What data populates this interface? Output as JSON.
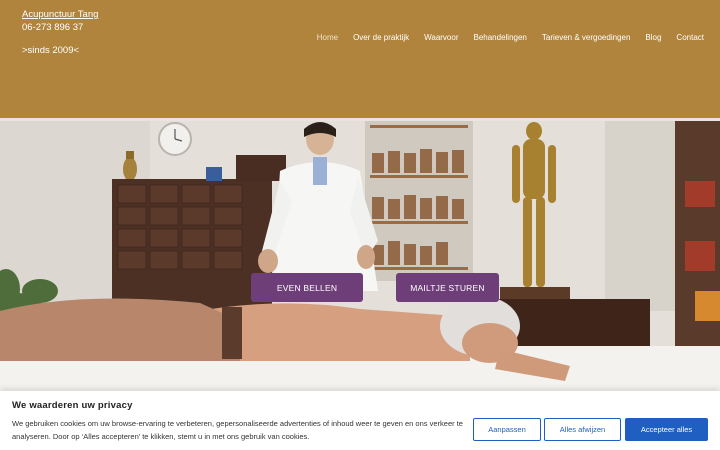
{
  "brand": {
    "name": "Acupunctuur Tang",
    "phone": "06-273 896 37",
    "since": ">sinds 2009<"
  },
  "nav": [
    {
      "label": "Home",
      "active": true
    },
    {
      "label": "Over de praktijk"
    },
    {
      "label": "Waarvoor"
    },
    {
      "label": "Behandelingen"
    },
    {
      "label": "Tarieven & vergoedingen"
    },
    {
      "label": "Blog"
    },
    {
      "label": "Contact"
    }
  ],
  "hero": {
    "image": "acupuncture-treatment-photo",
    "cta_call": "EVEN BELLEN",
    "cta_mail": "MAILTJE STUREN"
  },
  "cookie": {
    "title": "We waarderen uw privacy",
    "text": "We gebruiken cookies om uw browse-ervaring te verbeteren, gepersonaliseerde advertenties of inhoud weer te geven en ons verkeer te analyseren. Door op ‘Alles accepteren’ te klikken, stemt u in met ons gebruik van cookies.",
    "customize": "Aanpassen",
    "reject": "Alles afwijzen",
    "accept": "Accepteer alles"
  },
  "colors": {
    "header": "#b0843d",
    "cta": "#6e3e79",
    "cookie_accent": "#1e5fc1"
  }
}
